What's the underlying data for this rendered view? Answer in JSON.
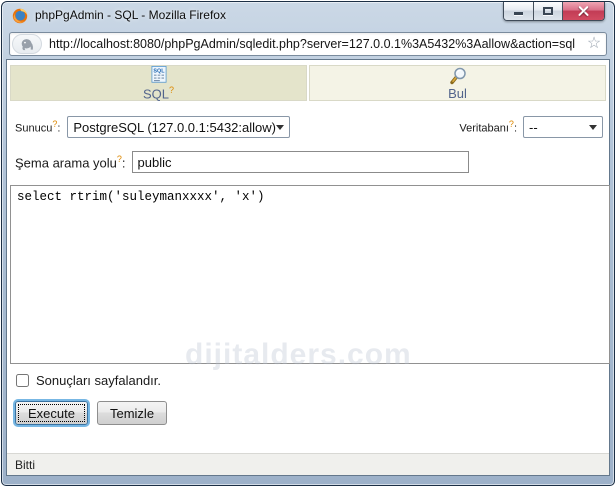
{
  "window": {
    "title": "phpPgAdmin - SQL - Mozilla Firefox"
  },
  "toolbar": {
    "url": "http://localhost:8080/phpPgAdmin/sqledit.php?server=127.0.0.1%3A5432%3Aallow&action=sql"
  },
  "icons": {
    "bookmark_star": "☆",
    "sql_doc_text": "SQL"
  },
  "tabs": {
    "sql": {
      "label": "SQL",
      "help": "?",
      "active": true
    },
    "find": {
      "label": "Bul",
      "active": false
    }
  },
  "form": {
    "server": {
      "label": "Sunucu",
      "help": "?",
      "colon": ":",
      "value": "PostgreSQL (127.0.0.1:5432:allow)"
    },
    "database": {
      "label": "Veritabanı",
      "help": "?",
      "colon": ":",
      "value": "--"
    },
    "search_path": {
      "label": "Şema arama yolu",
      "help": "?",
      "colon": ":",
      "value": "public"
    },
    "sql_query": "select rtrim('suleymanxxxx', 'x')",
    "paginate": {
      "label": "Sonuçları sayfalandır.",
      "checked": false
    }
  },
  "buttons": {
    "execute": "Execute",
    "clear": "Temizle"
  },
  "watermark": {
    "text": "dijitalders.com"
  },
  "statusbar": {
    "text": "Bitti"
  },
  "colors": {
    "tab_sql_bg": "#e4e4cb",
    "tab_find_bg": "#f4f3e6",
    "tab_label": "#52648c",
    "help_marker": "#dd8800",
    "close_button_red": "#c23c55",
    "frame_blue": "#a6bad0",
    "status_bg": "#f0f0ed"
  }
}
